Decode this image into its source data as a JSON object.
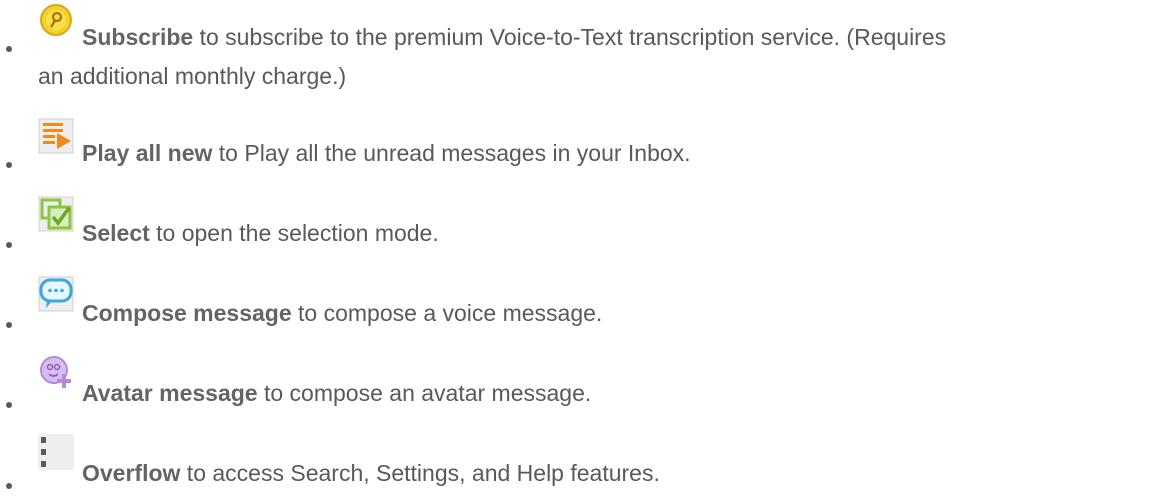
{
  "items": [
    {
      "icon": "subscribe-key-icon",
      "bold": "Subscribe",
      "text": " to subscribe to the premium Voice-to-Text transcription service. (Requires",
      "continuation": "an additional monthly charge.)"
    },
    {
      "icon": "play-all-new-icon",
      "bold": "Play all new",
      "text": " to Play all the unread messages in your Inbox."
    },
    {
      "icon": "select-checkbox-icon",
      "bold": "Select",
      "text": " to open the selection mode."
    },
    {
      "icon": "compose-message-bubble-icon",
      "bold": "Compose message",
      "text": " to compose a voice message."
    },
    {
      "icon": "avatar-message-icon",
      "bold": "Avatar message",
      "text": " to compose an avatar message."
    },
    {
      "icon": "overflow-menu-icon",
      "bold": "Overflow",
      "text": " to access Search, Settings, and Help features."
    }
  ],
  "colors": {
    "text": "#595959",
    "subscribe_icon": "#f2d22a",
    "play_icon": "#f08a1c",
    "select_icon": "#8cc63f",
    "compose_icon": "#3aa7e0",
    "avatar_icon": "#b58ad6",
    "overflow_icon": "#5a5a5a"
  }
}
